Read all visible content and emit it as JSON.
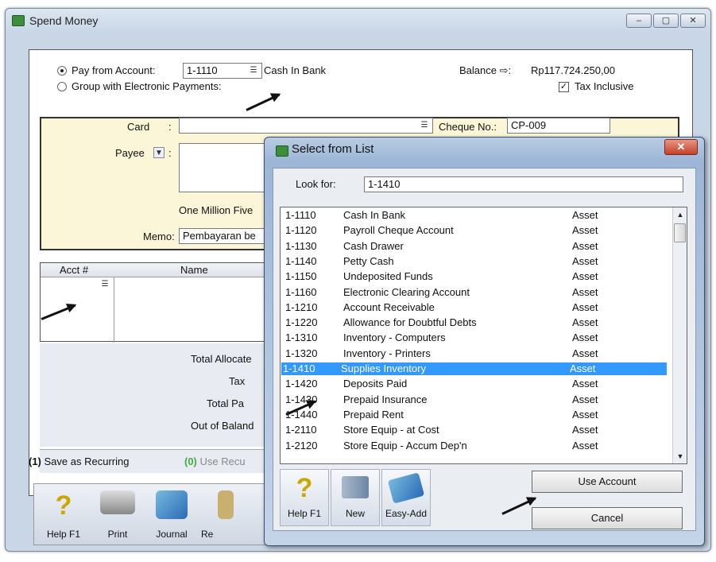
{
  "window": {
    "title": "Spend Money",
    "minimize": "–",
    "maximize": "▢",
    "close": "✕"
  },
  "payment": {
    "pay_from_label": "Pay from Account:",
    "account_value": "1-1110",
    "account_name": "Cash In Bank",
    "group_label": "Group with Electronic Payments:",
    "balance_label": "Balance ⇨:",
    "balance_value": "Rp117.724.250,00",
    "tax_inclusive_label": "Tax Inclusive"
  },
  "card": {
    "card_label": "Card",
    "payee_label": "Payee",
    "cheque_label": "Cheque No.:",
    "cheque_value": "CP-009",
    "amount_words": "One Million Five",
    "memo_label": "Memo:",
    "memo_value": "Pembayaran be"
  },
  "grid": {
    "col_acct": "Acct #",
    "col_name": "Name"
  },
  "totals": {
    "total_allocated": "Total Allocate",
    "tax": "Tax",
    "total_paid": "Total Pa",
    "out_of_balance": "Out of Baland"
  },
  "recurring": {
    "save": "Save as Recurring",
    "use": "Use Recu"
  },
  "toolbar": {
    "help": "Help F1",
    "print": "Print",
    "journal": "Journal",
    "re": "Re"
  },
  "dialog": {
    "title": "Select from List",
    "close": "✕",
    "look_for_label": "Look for:",
    "look_for_value": "1-1410",
    "accounts": [
      {
        "code": "1-1110",
        "name": "Cash In Bank",
        "type": "Asset"
      },
      {
        "code": "1-1120",
        "name": "Payroll Cheque Account",
        "type": "Asset"
      },
      {
        "code": "1-1130",
        "name": "Cash Drawer",
        "type": "Asset"
      },
      {
        "code": "1-1140",
        "name": "Petty Cash",
        "type": "Asset"
      },
      {
        "code": "1-1150",
        "name": "Undeposited Funds",
        "type": "Asset"
      },
      {
        "code": "1-1160",
        "name": "Electronic Clearing Account",
        "type": "Asset"
      },
      {
        "code": "1-1210",
        "name": "Account Receivable",
        "type": "Asset"
      },
      {
        "code": "1-1220",
        "name": "Allowance for Doubtful Debts",
        "type": "Asset"
      },
      {
        "code": "1-1310",
        "name": "Inventory - Computers",
        "type": "Asset"
      },
      {
        "code": "1-1320",
        "name": "Inventory - Printers",
        "type": "Asset"
      },
      {
        "code": "1-1410",
        "name": "Supplies Inventory",
        "type": "Asset"
      },
      {
        "code": "1-1420",
        "name": "Deposits Paid",
        "type": "Asset"
      },
      {
        "code": "1-1430",
        "name": "Prepaid Insurance",
        "type": "Asset"
      },
      {
        "code": "1-1440",
        "name": "Prepaid Rent",
        "type": "Asset"
      },
      {
        "code": "1-2110",
        "name": "Store Equip - at Cost",
        "type": "Asset"
      },
      {
        "code": "1-2120",
        "name": "Store Equip - Accum Dep'n",
        "type": "Asset"
      }
    ],
    "selected_code": "1-1410",
    "help": "Help F1",
    "new": "New",
    "easy_add": "Easy-Add",
    "use_account": "Use Account",
    "cancel": "Cancel"
  }
}
